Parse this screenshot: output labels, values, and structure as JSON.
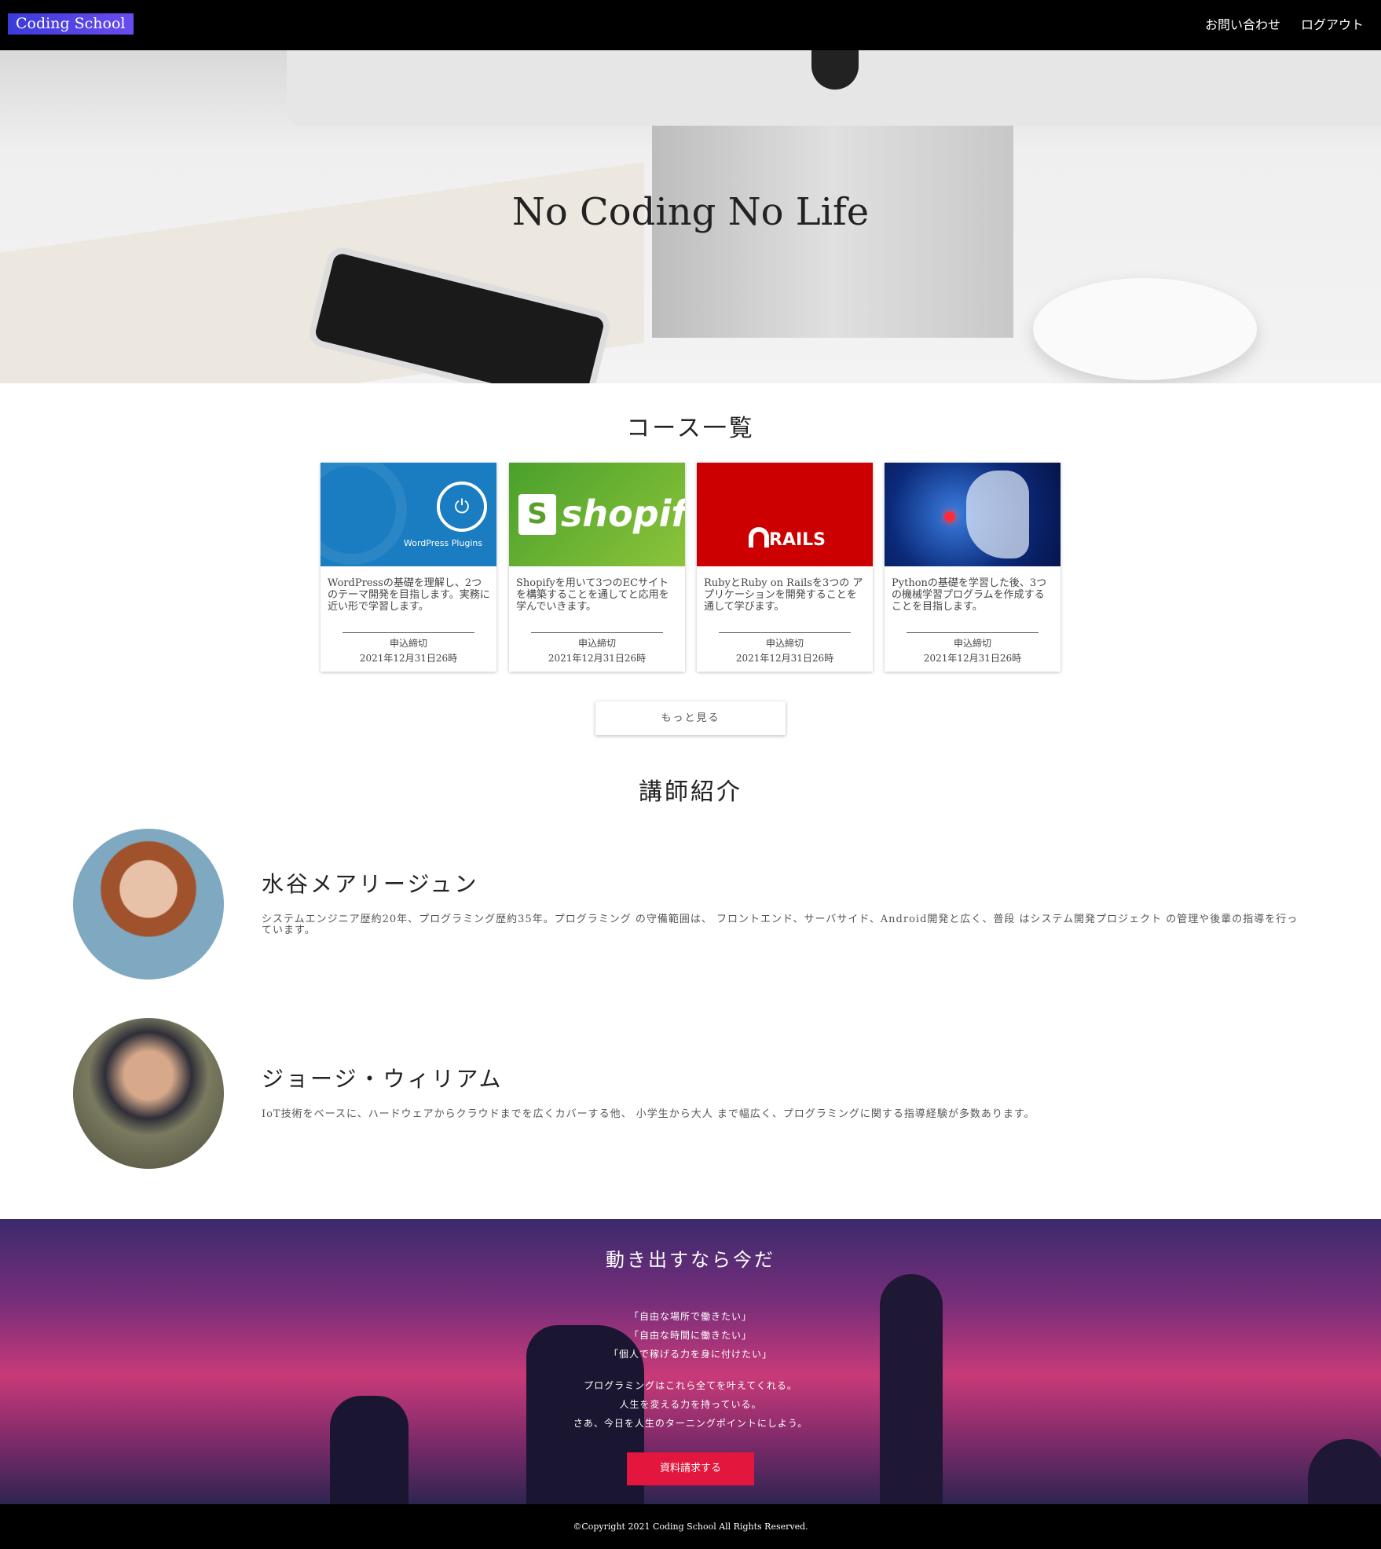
{
  "header": {
    "logo": "Coding School",
    "nav": [
      "お問い合わせ",
      "ログアウト"
    ]
  },
  "hero": {
    "title": "No Coding No Life"
  },
  "courses": {
    "title": "コース一覧",
    "items": [
      {
        "image_text": "WordPress Plugins",
        "description": "WordPressの基礎を理解し、2つのテーマ開発を目指します。実務に近い形で学習します。",
        "deadline_label": "申込締切",
        "deadline": "2021年12月31日26時"
      },
      {
        "image_text": "shopify",
        "description": "Shopifyを用いて3つのECサイトを構築することを通してと応用を学んでいきます。",
        "deadline_label": "申込締切",
        "deadline": "2021年12月31日26時"
      },
      {
        "image_text": "RAILS",
        "description": "RubyとRuby on Railsを3つの アプリケーションを開発することを通して学びます。",
        "deadline_label": "申込締切",
        "deadline": "2021年12月31日26時"
      },
      {
        "image_text": "",
        "description": "Pythonの基礎を学習した後、3つの機械学習プログラムを作成することを目指します。",
        "deadline_label": "申込締切",
        "deadline": "2021年12月31日26時"
      }
    ],
    "more": "もっと見る"
  },
  "instructors": {
    "title": "講師紹介",
    "items": [
      {
        "name": "水谷メアリージュン",
        "description": "システムエンジニア歴約20年、プログラミング歴約35年。プログラミング の守備範囲は、 フロントエンド、サーバサイド、Android開発と広く、普段 はシステム開発プロジェクト の管理や後輩の指導を行っています。"
      },
      {
        "name": "ジョージ・ウィリアム",
        "description": "IoT技術をベースに、ハードウェアからクラウドまでを広くカバーする他、 小学生から大人 まで幅広く、プログラミングに関する指導経験が多数あります。"
      }
    ]
  },
  "cta": {
    "title": "動き出すなら今だ",
    "lines": [
      "「自由な場所で働きたい」",
      "「自由な時間に働きたい」",
      "「個人で稼げる力を身に付けたい」",
      "プログラミングはこれら全てを叶えてくれる。",
      "人生を変える力を持っている。",
      "さあ、今日を人生のターニングポイントにしよう。"
    ],
    "button": "資料請求する",
    "accent": "#e3173d"
  },
  "footer": {
    "copyright": "©Copyright 2021 Coding School All Rights Reserved."
  }
}
